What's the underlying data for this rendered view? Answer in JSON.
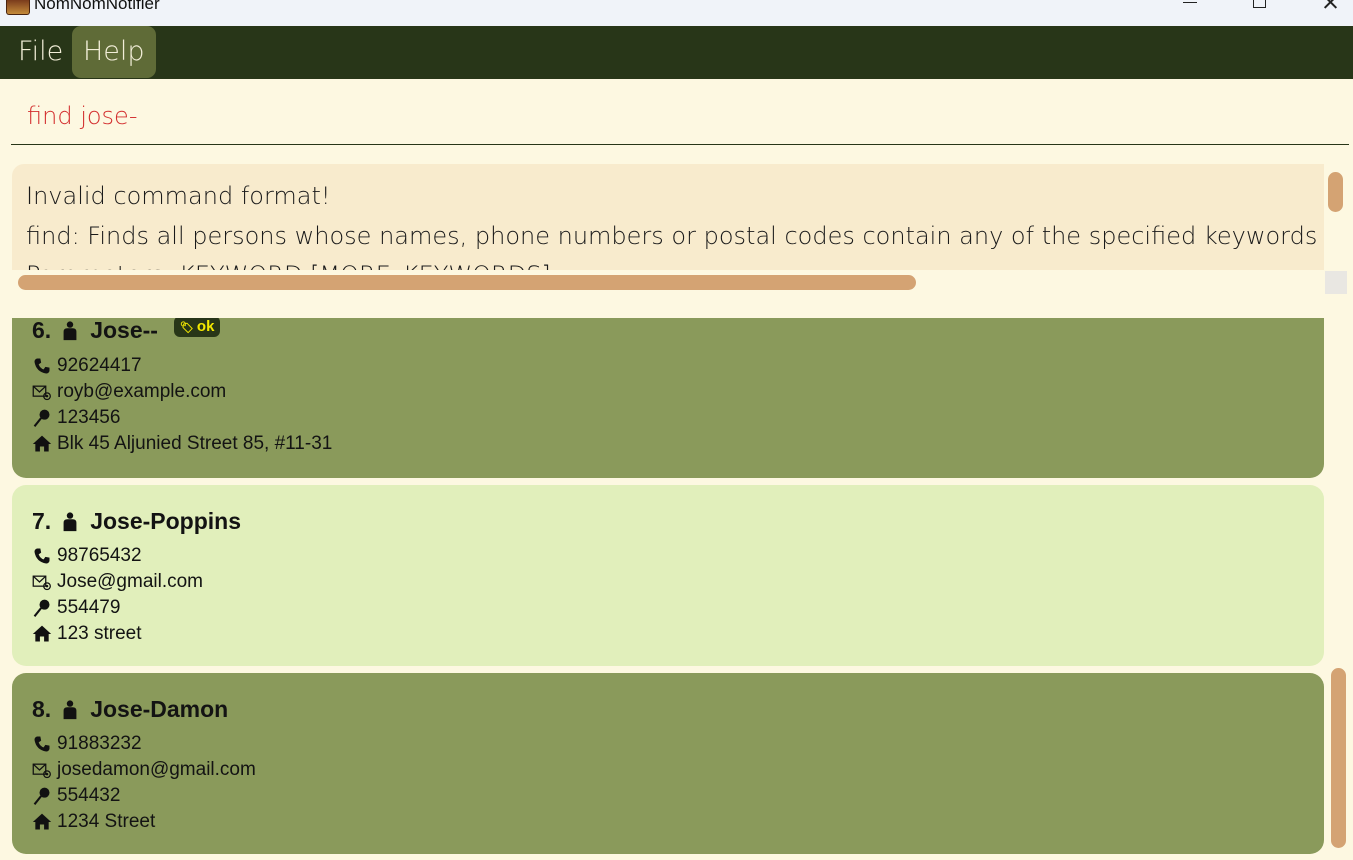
{
  "window": {
    "title": "NomNomNotifier"
  },
  "menu": {
    "file": "File",
    "help": "Help"
  },
  "command": {
    "text": "find jose-"
  },
  "result": {
    "lines": [
      "Invalid command format!",
      "find: Finds all persons whose names, phone numbers or postal codes contain any of the specified keywords (case-insens",
      "Parameters: KEYWORD [MORE_KEYWORDS]..."
    ]
  },
  "persons": [
    {
      "index": "6.",
      "name": "Jose--",
      "tag": "ok",
      "phone": "92624417",
      "email": "royb@example.com",
      "postal": "123456",
      "address": "Blk 45 Aljunied Street 85, #11-31"
    },
    {
      "index": "7.",
      "name": "Jose-Poppins",
      "tag": "",
      "phone": "98765432",
      "email": "Jose@gmail.com",
      "postal": "554479",
      "address": "123 street"
    },
    {
      "index": "8.",
      "name": "Jose-Damon",
      "tag": "",
      "phone": "91883232",
      "email": "josedamon@gmail.com",
      "postal": "554432",
      "address": "1234 Street"
    }
  ],
  "icons": {
    "person": "person-icon",
    "phone": "phone-icon",
    "email": "email-icon",
    "postal": "pin-icon",
    "address": "home-icon",
    "tag": "tag-icon"
  },
  "colors": {
    "menubar": "#283618",
    "card_dark": "#8a9a5b",
    "card_light": "#e1efbb",
    "scrollbar": "#d4a373",
    "command_text": "#d32f2f",
    "tag_text": "#f4e900"
  }
}
